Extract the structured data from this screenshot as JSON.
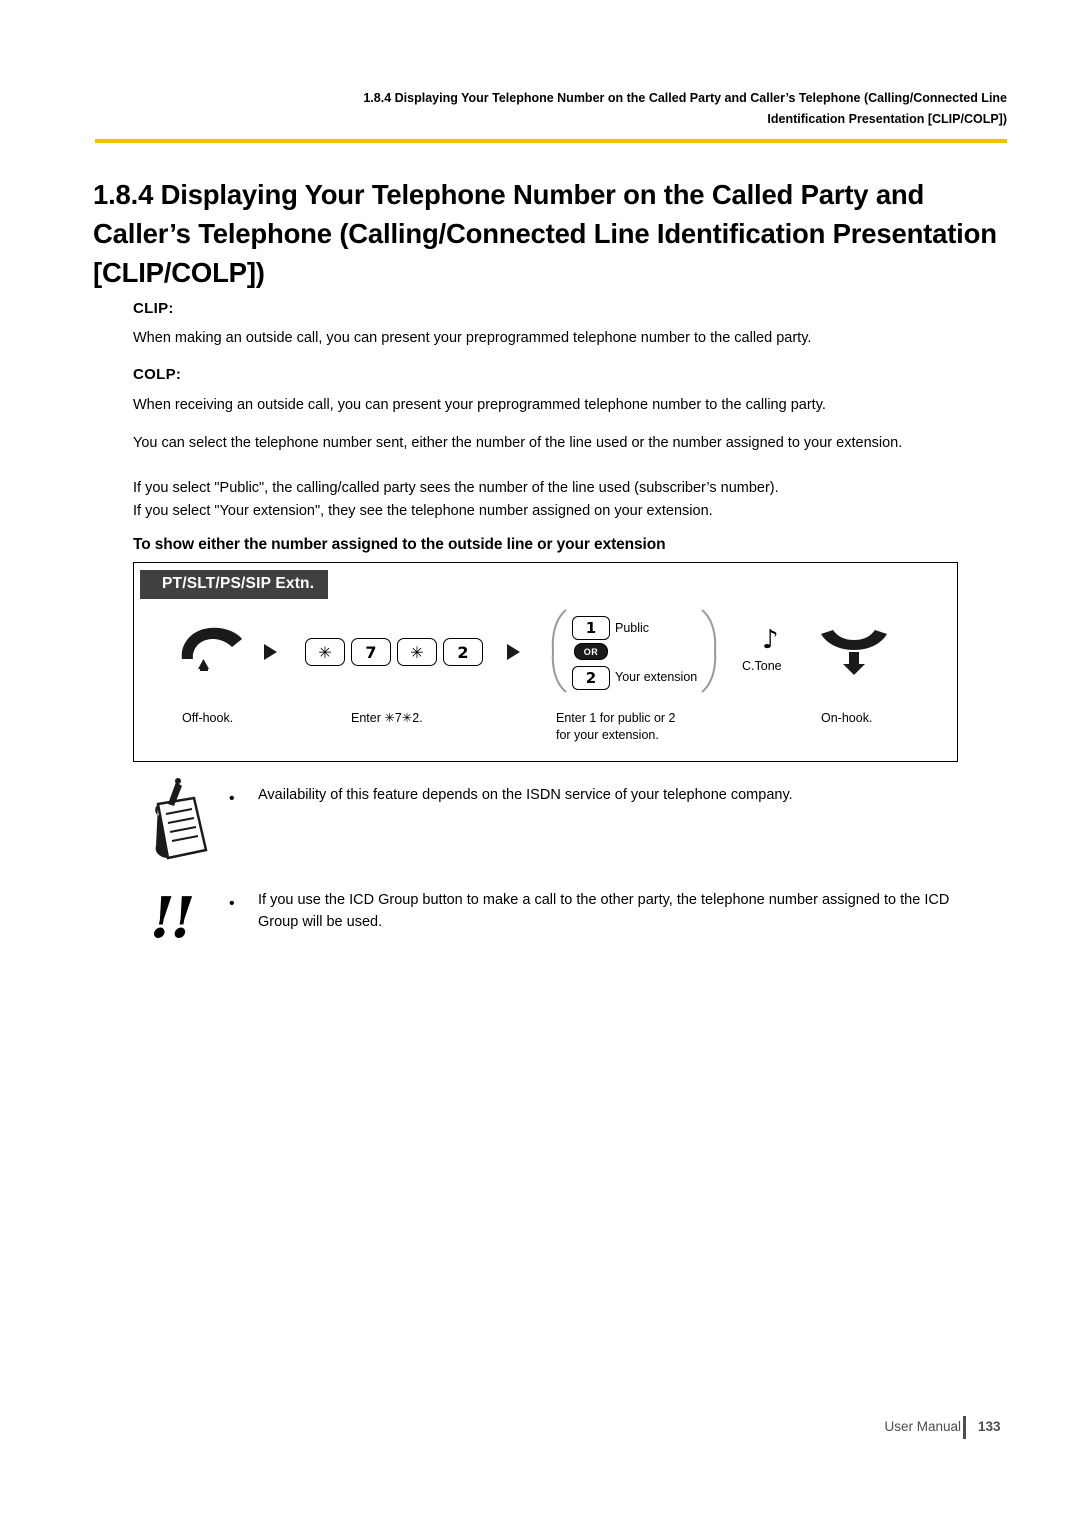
{
  "header": {
    "line1": "1.8.4 Displaying Your Telephone Number on the Called Party and Caller’s Telephone (Calling/Connected Line",
    "line2": "Identification Presentation [CLIP/COLP])",
    "rule_color": "#f2c200"
  },
  "title": "1.8.4  Displaying Your Telephone Number on the Called Party and Caller’s Telephone (Calling/Connected Line Identification Presentation [CLIP/COLP])",
  "sections": {
    "clip_label": "CLIP:",
    "clip_text": "When making an outside call, you can present your preprogrammed telephone number to the called party.",
    "colp_label": "COLP:",
    "colp_text": "When receiving an outside call, you can present your preprogrammed telephone number to the calling party.",
    "select_text": "You can select the telephone number sent, either the number of the line used or the number assigned to your extension.",
    "public_text": "If you select \"Public\", the calling/called party sees the number of the line used (subscriber’s number).",
    "extension_text": "If you select \"Your extension\", they see the telephone number assigned on your extension."
  },
  "procedure": {
    "heading": "To show either the number assigned to the outside line or your extension",
    "phone_types": "PT/SLT/PS/SIP Extn.",
    "keys": [
      "✳",
      "7",
      "✳",
      "2"
    ],
    "options": [
      {
        "key": "1",
        "label": "Public"
      },
      {
        "key": "2",
        "label": "Your extension"
      }
    ],
    "or_badge": "OR",
    "tone_label": "C.Tone",
    "captions": {
      "offhook": "Off-hook.",
      "enter": "Enter ✳7✳2.",
      "options_line1": "Enter 1 for public or 2",
      "options_line2": "for your extension.",
      "onhook": "On-hook."
    }
  },
  "notes": [
    {
      "bullet": "•",
      "text": "Availability of this feature depends on the ISDN service of your telephone company."
    },
    {
      "bullet": "•",
      "text": "If you use the ICD Group button to make a call to the other party, the telephone number assigned to the ICD Group will be used."
    }
  ],
  "footer": {
    "label": "User Manual",
    "page": "133"
  }
}
